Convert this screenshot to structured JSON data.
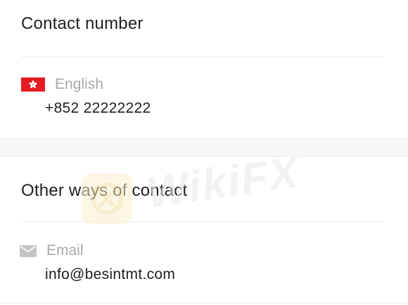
{
  "contact_section": {
    "title": "Contact number",
    "phone": {
      "flag_icon": "hong-kong-flag-icon",
      "label": "English",
      "value": "+852 22222222"
    }
  },
  "other_section": {
    "title": "Other ways of contact",
    "email": {
      "icon": "envelope-icon",
      "label": "Email",
      "value": "info@besintmt.com"
    }
  },
  "watermark": {
    "text": "WikiFX"
  },
  "colors": {
    "flag_red": "#e21c21",
    "label_gray": "#a8a8a8",
    "icon_gray": "#c4c4c4",
    "page_background": "#f7f7f7"
  }
}
